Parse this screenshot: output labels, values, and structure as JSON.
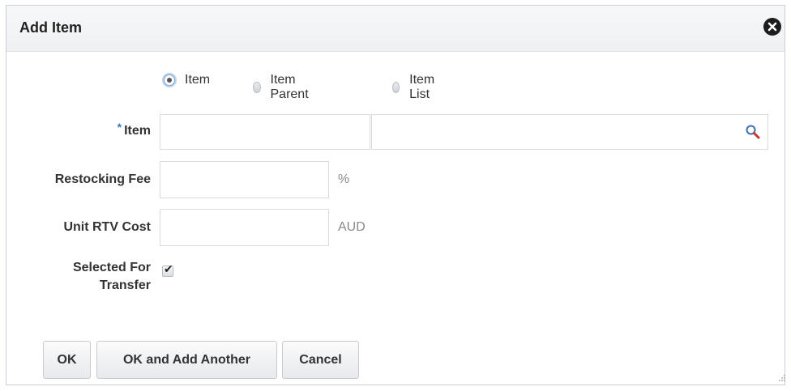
{
  "dialog": {
    "title": "Add Item",
    "close_icon": "close-circle-icon"
  },
  "radio_group": {
    "options": [
      {
        "label": "Item",
        "selected": true
      },
      {
        "label": "Item Parent",
        "selected": false
      },
      {
        "label": "Item List",
        "selected": false
      }
    ]
  },
  "form": {
    "item": {
      "required_marker": "*",
      "label": "Item",
      "value": "",
      "description": "",
      "search_icon": "search-icon"
    },
    "restocking_fee": {
      "label": "Restocking Fee",
      "value": "",
      "unit": "%"
    },
    "unit_rtv_cost": {
      "label": "Unit RTV Cost",
      "value": "",
      "unit": "AUD"
    },
    "selected_for_transfer": {
      "label_line1": "Selected For",
      "label_line2": "Transfer",
      "checked": true
    }
  },
  "buttons": {
    "ok": "OK",
    "ok_add_another": "OK and Add Another",
    "cancel": "Cancel"
  }
}
